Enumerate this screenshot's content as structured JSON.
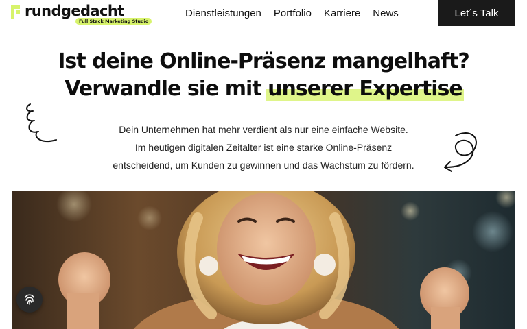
{
  "brand": {
    "name": "rundgedacht",
    "tagline": "Full Stack Marketing Studio",
    "accent_color": "#d7f36b",
    "logo_icon": "logo-mark-icon"
  },
  "nav": {
    "items": [
      "Dienstleistungen",
      "Portfolio",
      "Karriere",
      "News"
    ],
    "cta_label": "Let´s Talk"
  },
  "hero": {
    "headline_line1": "Ist deine Online-Präsenz mangelhaft?",
    "headline_line2_prefix": "Verwandle sie mit",
    "headline_line2_highlight": "unserer Expertise",
    "intro_line1": "Dein Unternehmen hat mehr verdient als nur eine einfache Website.",
    "intro_line2": "Im heutigen digitalen Zeitalter ist eine starke Online-Präsenz",
    "intro_line3": "entscheidend, um Kunden zu gewinnen und das Wachstum zu fördern.",
    "image_subject": "smiling woman with curly blonde hair, fists raised in celebration"
  },
  "widgets": {
    "fingerprint_icon": "fingerprint-icon"
  }
}
